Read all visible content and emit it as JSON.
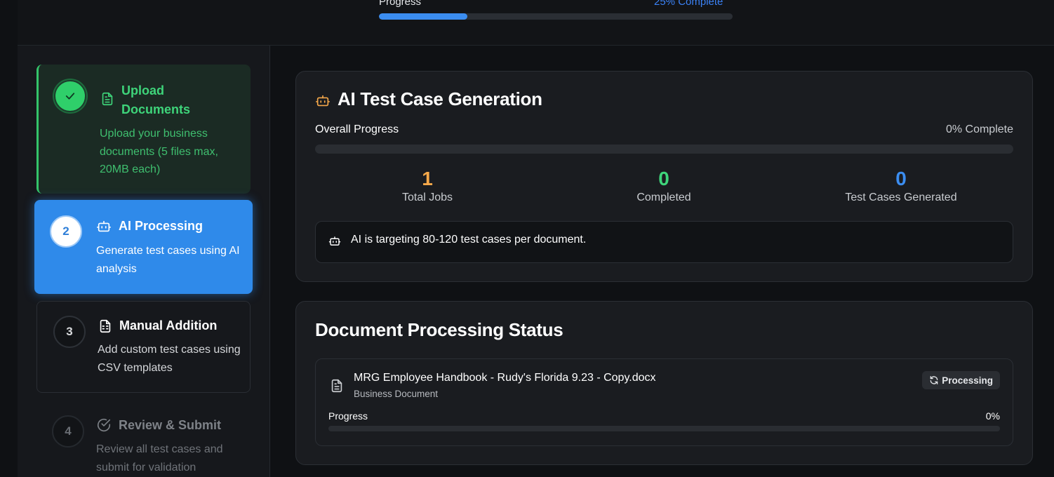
{
  "header": {
    "progress_label": "Progress",
    "progress_text": "25% Complete",
    "progress_value": 0.25
  },
  "steps": [
    {
      "number": "",
      "title": "Upload Documents",
      "description": "Upload your business documents (5 files max, 20MB each)",
      "state": "completed",
      "icon": "file-text-icon"
    },
    {
      "number": "2",
      "title": "AI Processing",
      "description": "Generate test cases using AI analysis",
      "state": "active",
      "icon": "bot-icon"
    },
    {
      "number": "3",
      "title": "Manual Addition",
      "description": "Add custom test cases using CSV templates",
      "state": "pending",
      "icon": "file-spreadsheet-icon"
    },
    {
      "number": "4",
      "title": "Review & Submit",
      "description": "Review all test cases and submit for validation",
      "state": "disabled",
      "icon": "check-circle-icon"
    }
  ],
  "generation": {
    "title": "AI Test Case Generation",
    "overall_label": "Overall Progress",
    "overall_text": "0% Complete",
    "overall_value": 0,
    "stats": [
      {
        "value": "1",
        "label": "Total Jobs",
        "color": "#f5a84a"
      },
      {
        "value": "0",
        "label": "Completed",
        "color": "#3ed47a"
      },
      {
        "value": "0",
        "label": "Test Cases Generated",
        "color": "#3b8df0"
      }
    ],
    "notice": "AI is targeting 80-120 test cases per document."
  },
  "documents": {
    "title": "Document Processing Status",
    "items": [
      {
        "name": "MRG Employee Handbook - Rudy's Florida 9.23 - Copy.docx",
        "type": "Business Document",
        "status": "Processing",
        "progress_label": "Progress",
        "progress_text": "0%",
        "progress_value": 0
      }
    ]
  },
  "colors": {
    "accent": "#3b8df0",
    "success": "#3ed47a",
    "warning": "#f5a84a"
  }
}
